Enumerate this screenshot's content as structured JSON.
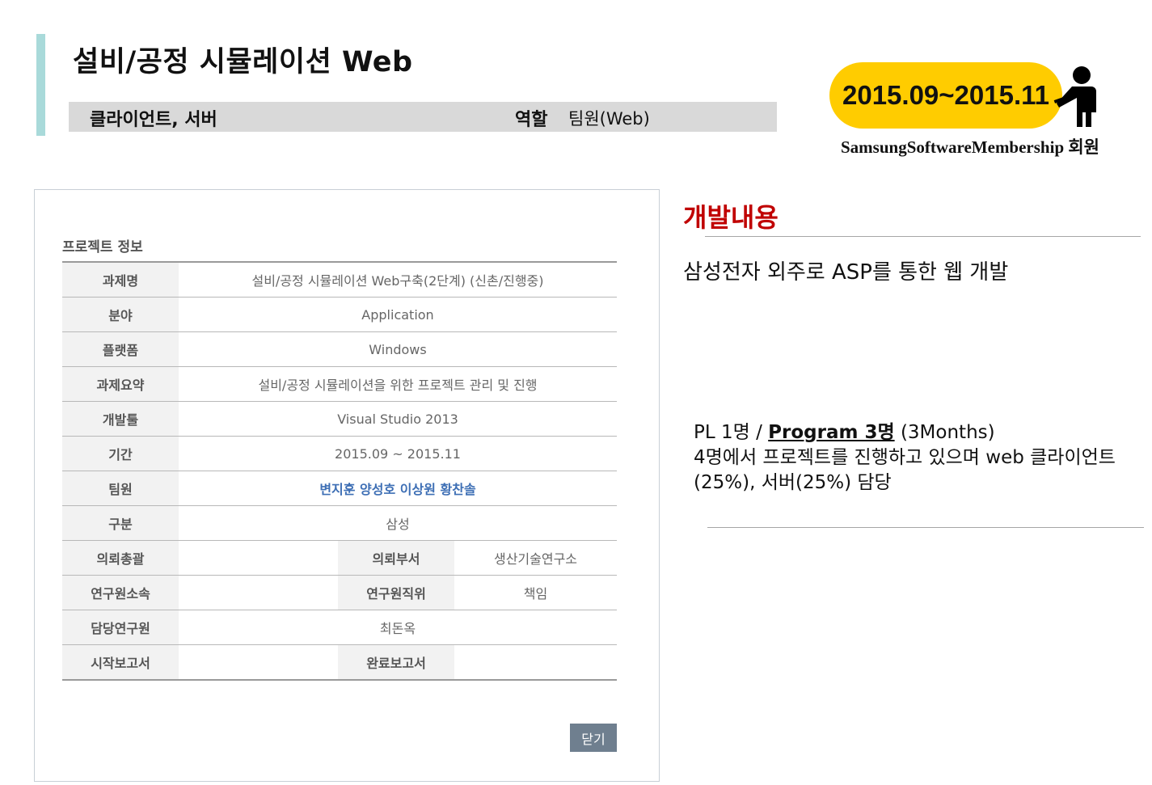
{
  "header": {
    "title": "설비/공정 시뮬레이션 Web",
    "strip_left": "클라이언트, 서버",
    "role_label": "역할",
    "role_value": "팀원(Web)"
  },
  "badge": {
    "period": "2015.09~2015.11",
    "member_caption": "SamsungSoftwareMembership 회원",
    "color": "#ffcc00",
    "icon": "person-presenting-icon"
  },
  "panel": {
    "heading": "프로젝트 정보",
    "rows": [
      {
        "label": "과제명",
        "value": "설비/공정 시뮬레이션 Web구축(2단계) (신촌/진행중)"
      },
      {
        "label": "분야",
        "value": "Application"
      },
      {
        "label": "플랫폼",
        "value": "Windows"
      },
      {
        "label": "과제요약",
        "value": "설비/공정 시뮬레이션을 위한 프로젝트 관리 및 진행"
      },
      {
        "label": "개발툴",
        "value": "Visual Studio 2013"
      },
      {
        "label": "기간",
        "value": "2015.09 ~ 2015.11"
      },
      {
        "label": "팀원",
        "value": "변지훈 양성호 이상원 황찬솔"
      },
      {
        "label": "구분",
        "value": "삼성"
      }
    ],
    "split_rows": [
      {
        "label1": "의뢰총괄",
        "value1": "",
        "label2": "의뢰부서",
        "value2": "생산기술연구소"
      },
      {
        "label1": "연구원소속",
        "value1": "",
        "label2": "연구원직위",
        "value2": "책임"
      }
    ],
    "researcher": {
      "label": "담당연구원",
      "value": "최돈옥"
    },
    "reports": {
      "label1": "시작보고서",
      "value1": "",
      "label2": "완료보고서",
      "value2": ""
    },
    "close_label": "닫기"
  },
  "dev": {
    "heading": "개발내용",
    "description": "삼성전자 외주로 ASP를 통한 웹 개발",
    "team_pl": "PL 1명   / ",
    "team_program": "Program  3명",
    "team_months": " (3Months)",
    "team_line2": "4명에서 프로젝트를 진행하고 있으며 web 클라이언트(25%), 서버(25%) 담당"
  }
}
